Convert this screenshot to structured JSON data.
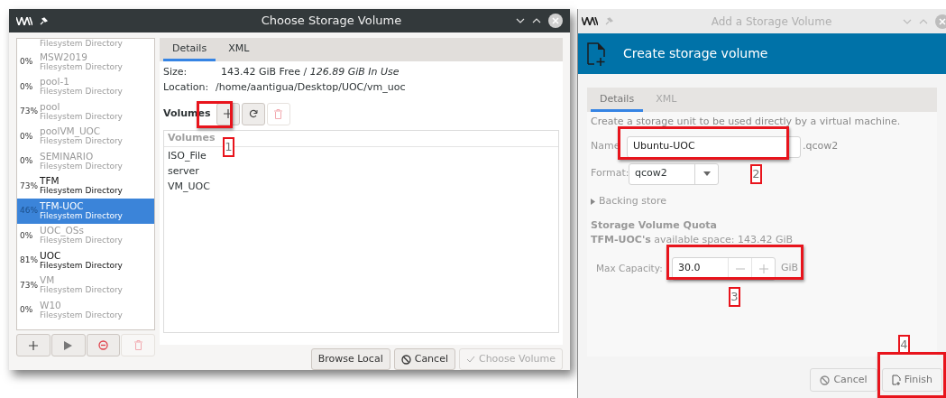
{
  "left_window": {
    "title": "Choose Storage Volume",
    "pool_partial": {
      "type": "Filesystem Directory"
    },
    "pools": [
      {
        "usage": "0%",
        "name": "MSW2019",
        "type": "Filesystem Directory",
        "active": false,
        "selected": false
      },
      {
        "usage": "0%",
        "name": "pool-1",
        "type": "Filesystem Directory",
        "active": false,
        "selected": false
      },
      {
        "usage": "73%",
        "name": "pool",
        "type": "Filesystem Directory",
        "active": false,
        "selected": false
      },
      {
        "usage": "0%",
        "name": "poolVM_UOC",
        "type": "Filesystem Directory",
        "active": false,
        "selected": false
      },
      {
        "usage": "0%",
        "name": "SEMINARIO",
        "type": "Filesystem Directory",
        "active": false,
        "selected": false
      },
      {
        "usage": "73%",
        "name": "TFM",
        "type": "Filesystem Directory",
        "active": true,
        "selected": false
      },
      {
        "usage": "46%",
        "name": "TFM-UOC",
        "type": "Filesystem Directory",
        "active": true,
        "selected": true
      },
      {
        "usage": "0%",
        "name": "UOC_OSs",
        "type": "Filesystem Directory",
        "active": false,
        "selected": false
      },
      {
        "usage": "81%",
        "name": "UOC",
        "type": "Filesystem Directory",
        "active": true,
        "selected": false
      },
      {
        "usage": "73%",
        "name": "VM",
        "type": "Filesystem Directory",
        "active": false,
        "selected": false
      },
      {
        "usage": "0%",
        "name": "W10",
        "type": "Filesystem Directory",
        "active": false,
        "selected": false
      }
    ],
    "pool_buttons": [
      {
        "kind": "add",
        "disabled": false
      },
      {
        "kind": "start",
        "disabled": false
      },
      {
        "kind": "stop",
        "disabled": false
      },
      {
        "kind": "delete",
        "disabled": true
      }
    ],
    "tabs": [
      {
        "label": "Details",
        "selected": true
      },
      {
        "label": "XML",
        "selected": false
      }
    ],
    "size_label": "Size:",
    "size_value": "143.42 GiB Free / *126.89 GiB In Use*",
    "location_label": "Location:",
    "location_value": "/home/aantigua/Desktop/UOC/vm_uoc",
    "volumes_label": "Volumes",
    "volume_buttons": [
      {
        "kind": "add",
        "disabled": false
      },
      {
        "kind": "refresh",
        "disabled": false
      },
      {
        "kind": "delete",
        "disabled": true
      }
    ],
    "volumes_header": "Volumes",
    "volumes": [
      "ISO_File",
      "server",
      "VM_UOC"
    ],
    "buttons": [
      {
        "kind": "browse",
        "label": "Browse Local",
        "disabled": false
      },
      {
        "kind": "cancel",
        "label": "Cancel",
        "disabled": false
      },
      {
        "kind": "choose",
        "label": "Choose Volume",
        "disabled": true
      }
    ]
  },
  "right_window": {
    "title": "Add a Storage Volume",
    "header": "Create storage volume",
    "tabs": [
      {
        "label": "Details",
        "selected": true,
        "disabled": false
      },
      {
        "label": "XML",
        "selected": false,
        "disabled": true
      }
    ],
    "description": "Create a storage unit to be used directly by a virtual machine.",
    "name_label": "Name",
    "name_value": "Ubuntu-UOC",
    "name_suffix": ".qcow2",
    "format_label": "Format:",
    "format_value": "qcow2",
    "backing_store": {
      "label": "Backing store",
      "expanded": false
    },
    "quota_title": "Storage Volume Quota",
    "quota_text": "**TFM-UOC's** available space: 143.42 GiB",
    "capacity_label": "Max Capacity:",
    "capacity_value": "30.0",
    "capacity_unit": "GiB",
    "buttons": [
      {
        "kind": "cancel",
        "label": "Cancel"
      },
      {
        "kind": "finish",
        "label": "Finish"
      }
    ]
  },
  "annotations": [
    {
      "label": "1"
    },
    {
      "label": "2"
    },
    {
      "label": "3"
    },
    {
      "label": "4"
    }
  ]
}
